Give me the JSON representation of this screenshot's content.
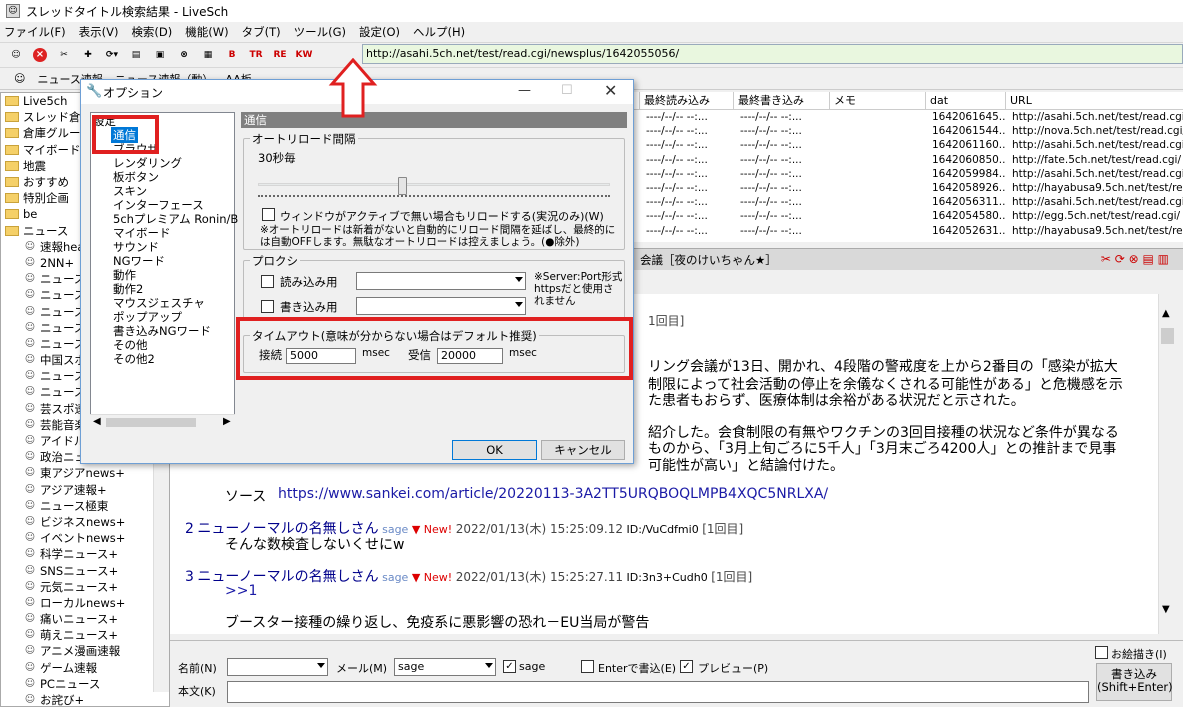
{
  "window": {
    "title": "スレッドタイトル検索結果 - LiveSch",
    "app_icon": "livesch-icon"
  },
  "menu": [
    "ファイル(F)",
    "表示(V)",
    "検索(D)",
    "機能(W)",
    "タブ(T)",
    "ツール(G)",
    "設定(O)",
    "ヘルプ(H)"
  ],
  "toolbar": {
    "url": "http://asahi.5ch.net/test/read.cgi/newsplus/1642055056/",
    "icons": [
      "ghost-icon",
      "stop-icon",
      "scissors-icon",
      "cross-icon",
      "refresh-icon",
      "copy-icon",
      "paste-icon",
      "find-icon",
      "board-icon",
      "bkn-icon",
      "trd-icon",
      "res-icon",
      "dat-icon"
    ],
    "btn_labels": [
      "B",
      "TR",
      "RE",
      "KW"
    ]
  },
  "bookmarks": [
    "ニュース速報",
    "ニュース速報（動）",
    "AA板"
  ],
  "tree": [
    {
      "type": "folder",
      "label": "Live5ch"
    },
    {
      "type": "folder",
      "label": "スレッド倉庫"
    },
    {
      "type": "folder",
      "label": "倉庫グルー"
    },
    {
      "type": "folder",
      "label": "マイボード"
    },
    {
      "type": "folder",
      "label": "地震"
    },
    {
      "type": "folder",
      "label": "おすすめ"
    },
    {
      "type": "folder",
      "label": "特別企画"
    },
    {
      "type": "folder",
      "label": "be"
    },
    {
      "type": "folder",
      "label": "ニュース"
    },
    {
      "type": "board",
      "label": "速報hea"
    },
    {
      "type": "board",
      "label": "2NN+"
    },
    {
      "type": "board",
      "label": "ニュース"
    },
    {
      "type": "board",
      "label": "ニュース"
    },
    {
      "type": "board",
      "label": "ニュース"
    },
    {
      "type": "board",
      "label": "ニュース"
    },
    {
      "type": "board",
      "label": "ニュース"
    },
    {
      "type": "board",
      "label": "中国スポ"
    },
    {
      "type": "board",
      "label": "ニュース"
    },
    {
      "type": "board",
      "label": "ニュース"
    },
    {
      "type": "board",
      "label": "芸スポ速"
    },
    {
      "type": "board",
      "label": "芸能音楽"
    },
    {
      "type": "board",
      "label": "アイドル"
    },
    {
      "type": "board",
      "label": "政治ニュ"
    },
    {
      "type": "board",
      "label": "東アジアnews+"
    },
    {
      "type": "board",
      "label": "アジア速報+"
    },
    {
      "type": "board",
      "label": "ニュース極東"
    },
    {
      "type": "board",
      "label": "ビジネスnews+"
    },
    {
      "type": "board",
      "label": "イベントnews+"
    },
    {
      "type": "board",
      "label": "科学ニュース+"
    },
    {
      "type": "board",
      "label": "SNSニュース+"
    },
    {
      "type": "board",
      "label": "元気ニュース+"
    },
    {
      "type": "board",
      "label": "ローカルnews+"
    },
    {
      "type": "board",
      "label": "痛いニュース+"
    },
    {
      "type": "board",
      "label": "萌えニュース+"
    },
    {
      "type": "board",
      "label": "アニメ漫画速報"
    },
    {
      "type": "board",
      "label": "ゲーム速報"
    },
    {
      "type": "board",
      "label": "PCニュース"
    },
    {
      "type": "board",
      "label": "お詫び+"
    }
  ],
  "list": {
    "headers": [
      "最終読み込み",
      "最終書き込み",
      "メモ",
      "dat",
      "URL"
    ],
    "rows": [
      {
        "read": "----/--/-- --:...",
        "write": "----/--/-- --:...",
        "dat": "1642061645...",
        "url": "http://asahi.5ch.net/test/read.cgi/"
      },
      {
        "read": "----/--/-- --:...",
        "write": "----/--/-- --:...",
        "dat": "1642061544...",
        "url": "http://nova.5ch.net/test/read.cgi/"
      },
      {
        "read": "----/--/-- --:...",
        "write": "----/--/-- --:...",
        "dat": "1642061160...",
        "url": "http://asahi.5ch.net/test/read.cgi/"
      },
      {
        "read": "----/--/-- --:...",
        "write": "----/--/-- --:...",
        "dat": "1642060850...",
        "url": "http://fate.5ch.net/test/read.cgi/"
      },
      {
        "read": "----/--/-- --:...",
        "write": "----/--/-- --:...",
        "dat": "1642059984...",
        "url": "http://asahi.5ch.net/test/read.cgi/"
      },
      {
        "read": "----/--/-- --:...",
        "write": "----/--/-- --:...",
        "dat": "1642058926...",
        "url": "http://hayabusa9.5ch.net/test/read"
      },
      {
        "read": "----/--/-- --:...",
        "write": "----/--/-- --:...",
        "dat": "1642056311...",
        "url": "http://asahi.5ch.net/test/read.cgi/"
      },
      {
        "read": "----/--/-- --:...",
        "write": "----/--/-- --:...",
        "dat": "1642054580...",
        "url": "http://egg.5ch.net/test/read.cgi/"
      },
      {
        "read": "----/--/-- --:...",
        "write": "----/--/-- --:...",
        "dat": "1642052631...",
        "url": "http://hayabusa9.5ch.net/test/read"
      }
    ]
  },
  "thread": {
    "title": "会議［夜のけいちゃん★］",
    "first_fragment": "1回目]",
    "body_lines": [
      "リング会議が13日、開かれ、4段階の警戒度を上から2番目の「感染が拡大",
      "制限によって社会活動の停止を余儀なくされる可能性がある」と危機感を示",
      "た患者もおらず、医療体制は余裕がある状況だと示された。",
      "紹介した。会食制限の有無やワクチンの3回目接種の状況など条件が異なる",
      "ものから、「3月上旬ごろに5千人」「3月末ごろ4200人」との推計まで見事",
      "可能性が高い」と結論付けた。"
    ],
    "source_label": "ソース",
    "source_url": "https://www.sankei.com/article/20220113-3A2TT5URQBOQLMPB4XQC5NRLXA/",
    "posts": [
      {
        "num": "2",
        "name": "ニューノーマルの名無しさん",
        "mail": "sage",
        "new": "▼ New!",
        "date": "2022/01/13(木) 15:25:09.12",
        "id": "ID:/VuCdfmi0",
        "count": "[1回目]",
        "body": "そんな数検査しないくせにw"
      },
      {
        "num": "3",
        "name": "ニューノーマルの名無しさん",
        "mail": "sage",
        "new": "▼ New!",
        "date": "2022/01/13(木) 15:25:27.11",
        "id": "ID:3n3+Cudh0",
        "count": "[1回目]",
        "body": ">>1"
      }
    ],
    "last_line": "ブースター接種の繰り返し、免疫系に悪影響の恐れ－EU当局が警告"
  },
  "compose": {
    "name_label": "名前(N)",
    "mail_label": "メール(M)",
    "mail_value": "sage",
    "sage_label": "sage",
    "enter_label": "Enterで書込(E)",
    "preview_label": "プレビュー(P)",
    "oekaki_label": "お絵描き(I)",
    "body_label": "本文(K)",
    "submit_label": "書き込み",
    "submit_sub": "(Shift+Enter)"
  },
  "dialog": {
    "title": "オプション",
    "tree_root": "設定",
    "tree_items": [
      "通信",
      "ブラウザ",
      "レンダリング",
      "板ボタン",
      "スキン",
      "インターフェース",
      "5chプレミアム Ronin/B",
      "マイボード",
      "サウンド",
      "NGワード",
      "動作",
      "動作2",
      "マウスジェスチャ",
      "ポップアップ",
      "書き込みNGワード",
      "その他",
      "その他2"
    ],
    "panel_header": "通信",
    "auto_reload": {
      "group": "オートリロード間隔",
      "value_label": "30秒毎",
      "slider_fraction": 0.41,
      "inactive_label": "ウィンドウがアクティブで無い場合もリロードする(実況のみ)(W)",
      "note": "※オートリロードは新着がないと自動的にリロード間隔を延ばし、最終的には自動OFFします。無駄なオートリロードは控えましょう。(●除外)"
    },
    "proxy": {
      "group": "プロクシ",
      "read_label": "読み込み用",
      "write_label": "書き込み用",
      "note": "※Server:Port形式 httpsだと使用されません"
    },
    "timeout": {
      "group": "タイムアウト(意味が分からない場合はデフォルト推奨)",
      "connect_label": "接続",
      "connect_value": "5000",
      "receive_label": "受信",
      "receive_value": "20000",
      "unit": "msec"
    },
    "ok_label": "OK",
    "cancel_label": "キャンセル"
  },
  "annotations": {
    "highlight_color": "#e02020"
  }
}
